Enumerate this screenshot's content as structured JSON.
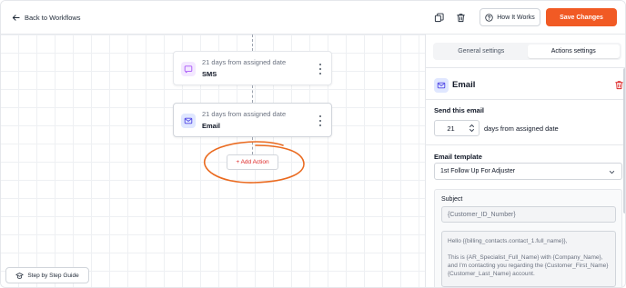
{
  "header": {
    "back_label": "Back to Workflows",
    "how_it_works_label": "How It Works",
    "save_label": "Save Changes",
    "accent_color": "#f15a24"
  },
  "canvas": {
    "nodes": [
      {
        "subtitle": "21 days from assigned date",
        "title": "SMS",
        "icon": "chat-bubble-icon",
        "icon_bg": "#f3e8ff",
        "icon_color": "#a855f7"
      },
      {
        "subtitle": "21 days from assigned date",
        "title": "Email",
        "icon": "mail-icon",
        "icon_bg": "#e0e7ff",
        "icon_color": "#4f46e5"
      }
    ],
    "add_action_label": "+ Add Action",
    "guide_label": "Step by Step Guide"
  },
  "panel": {
    "tabs": [
      {
        "label": "General settings",
        "active": false
      },
      {
        "label": "Actions settings",
        "active": true
      }
    ],
    "action_title": "Email",
    "send_label": "Send this email",
    "days_value": "21",
    "days_suffix": "days from assigned date",
    "template_label": "Email template",
    "template_value": "1st Follow Up For Adjuster",
    "subject_label": "Subject",
    "subject_value": "{Customer_ID_Number}",
    "body_line1": "Hello {{billing_contacts.contact_1.full_name}},",
    "body_line2": "This is {AR_Specialist_Full_Name} with {Company_Name}, and I'm contacting you regarding the {Customer_First_Name} {Customer_Last_Name} account."
  }
}
